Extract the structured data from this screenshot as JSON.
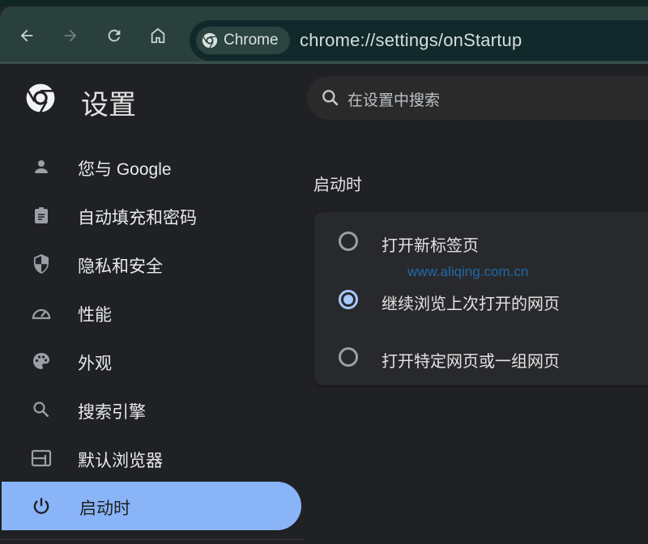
{
  "browser": {
    "nav": {
      "back": "back-arrow-icon",
      "forward": "forward-arrow-icon",
      "reload": "reload-icon",
      "home": "home-icon"
    },
    "omnibox": {
      "chip_label": "Chrome",
      "url": "chrome://settings/onStartup"
    }
  },
  "header": {
    "title": "设置",
    "search_placeholder": "在设置中搜索"
  },
  "sidebar": {
    "items": [
      {
        "label": "您与 Google",
        "icon": "person-icon",
        "active": false
      },
      {
        "label": "自动填充和密码",
        "icon": "clipboard-icon",
        "active": false
      },
      {
        "label": "隐私和安全",
        "icon": "shield-icon",
        "active": false
      },
      {
        "label": "性能",
        "icon": "speedometer-icon",
        "active": false
      },
      {
        "label": "外观",
        "icon": "palette-icon",
        "active": false
      },
      {
        "label": "搜索引擎",
        "icon": "search-icon",
        "active": false
      },
      {
        "label": "默认浏览器",
        "icon": "browser-window-icon",
        "active": false
      },
      {
        "label": "启动时",
        "icon": "power-icon",
        "active": true
      }
    ]
  },
  "main": {
    "section_title": "启动时",
    "options": [
      {
        "label": "打开新标签页",
        "checked": false
      },
      {
        "label": "继续浏览上次打开的网页",
        "checked": true
      },
      {
        "label": "打开特定网页或一组网页",
        "checked": false
      }
    ],
    "watermark": "www.aliqing.com.cn"
  },
  "colors": {
    "accent": "#8ab4f8",
    "radio_checked": "#a8c7fa",
    "toolbar": "#2a403c",
    "background": "#202124"
  }
}
